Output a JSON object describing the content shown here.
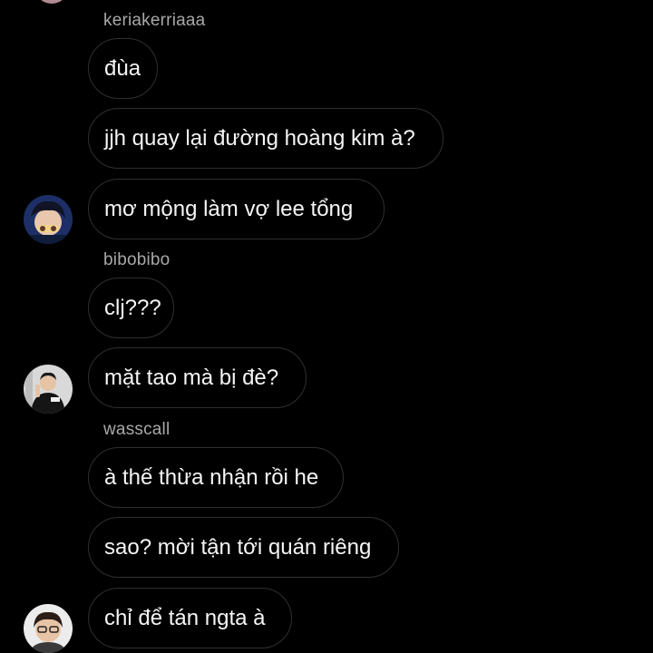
{
  "chat": {
    "groups": [
      {
        "username": "keriakerriaaa",
        "avatar_icon": "user-avatar-icon",
        "messages": [
          "đùa",
          "jjh quay lại đường hoàng kim à?",
          "mơ mộng làm vợ lee tổng"
        ]
      },
      {
        "username": "bibobibo",
        "avatar_icon": "user-avatar-icon",
        "messages": [
          "clj???",
          "mặt tao mà bị đè?"
        ]
      },
      {
        "username": "wasscall",
        "avatar_icon": "user-avatar-icon",
        "messages": [
          "à thế thừa nhận rồi he",
          "sao? mời tận tới quán riêng",
          "chỉ để tán ngta à"
        ]
      }
    ]
  },
  "colors": {
    "background": "#000000",
    "bubble_border": "#2f2f2f",
    "text": "#f5f5f5",
    "username": "#a8a8a8"
  }
}
